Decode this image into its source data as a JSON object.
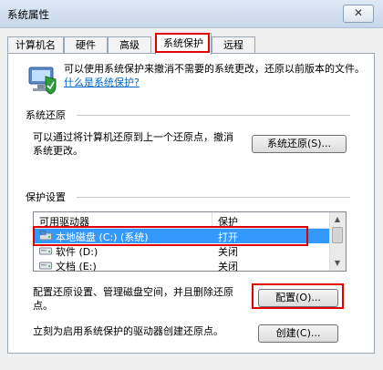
{
  "window": {
    "title": "系统属性",
    "close_glyph": "✕"
  },
  "tabs": [
    {
      "label": "计算机名"
    },
    {
      "label": "硬件"
    },
    {
      "label": "高级"
    },
    {
      "label": "系统保护"
    },
    {
      "label": "远程"
    }
  ],
  "intro": {
    "text": "可以使用系统保护来撤消不需要的系统更改，还原以前版本的文件。",
    "link": "什么是系统保护?"
  },
  "restore": {
    "title": "系统还原",
    "desc": "可以通过将计算机还原到上一个还原点，撤消系统更改。",
    "button": "系统还原(S)..."
  },
  "protection": {
    "title": "保护设置",
    "col_drive": "可用驱动器",
    "col_protect": "保护",
    "drives": [
      {
        "name": "本地磁盘 (C:) (系统)",
        "state": "打开"
      },
      {
        "name": "软件 (D:)",
        "state": "关闭"
      },
      {
        "name": "文档 (E:)",
        "state": "关闭"
      }
    ],
    "config_desc": "配置还原设置、管理磁盘空间，并且删除还原点。",
    "config_button": "配置(O)...",
    "create_desc": "立刻为启用系统保护的驱动器创建还原点。",
    "create_button": "创建(C)..."
  },
  "colors": {
    "highlight": "#e00000",
    "selection": "#3399ff",
    "link": "#0066cc"
  }
}
